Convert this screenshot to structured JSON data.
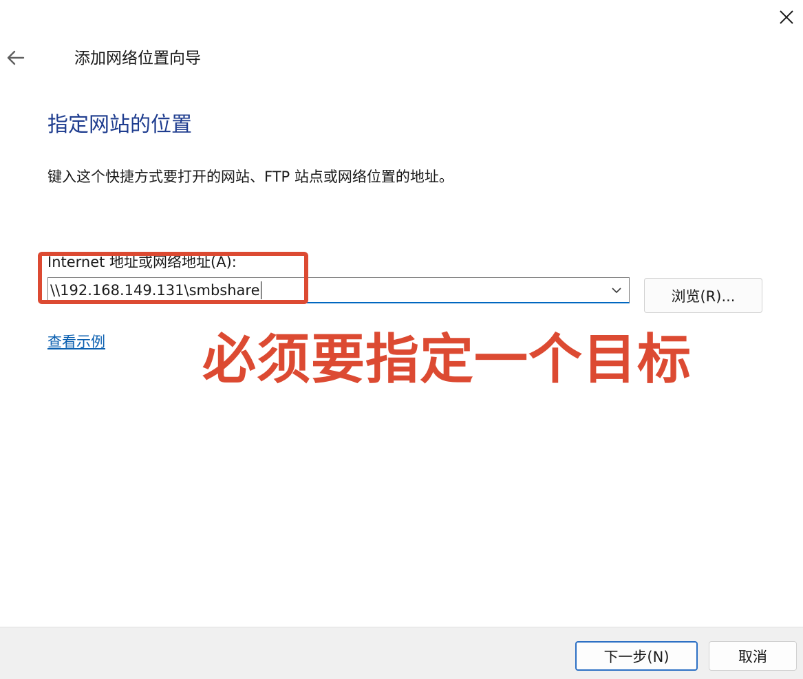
{
  "window": {
    "title": "添加网络位置向导",
    "close_icon": "close-icon",
    "back_icon": "back-arrow-icon"
  },
  "page": {
    "heading": "指定网站的位置",
    "description": "键入这个快捷方式要打开的网站、FTP 站点或网络位置的地址。"
  },
  "address": {
    "label": "Internet 地址或网络地址(A):",
    "value": "\\\\192.168.149.131\\smbshare",
    "dropdown_icon": "chevron-down-icon",
    "browse_label": "浏览(R)..."
  },
  "example_link": "查看示例",
  "annotation": {
    "text": "必须要指定一个目标",
    "color": "#dc4a32"
  },
  "footer": {
    "next_label": "下一步(N)",
    "cancel_label": "取消"
  },
  "colors": {
    "heading": "#1f3d8f",
    "link": "#0a5fb0",
    "accent": "#0067c0",
    "footer_bg": "#f0f0f0"
  }
}
